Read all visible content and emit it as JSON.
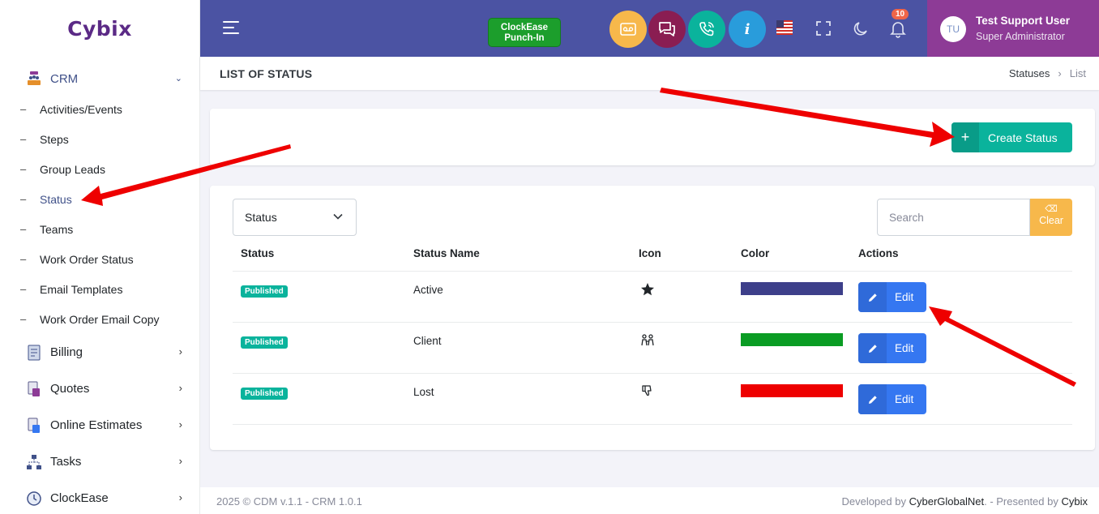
{
  "brand": {
    "logo_text": "Cybix"
  },
  "sidebar": {
    "crm": {
      "label": "CRM"
    },
    "crm_items": [
      {
        "label": "Activities/Events"
      },
      {
        "label": "Steps"
      },
      {
        "label": "Group Leads"
      },
      {
        "label": "Status",
        "active": true
      },
      {
        "label": "Teams"
      },
      {
        "label": "Work Order Status"
      },
      {
        "label": "Email Templates"
      },
      {
        "label": "Work Order Email Copy"
      }
    ],
    "main_items": [
      {
        "label": "Billing",
        "icon": "billing-icon"
      },
      {
        "label": "Quotes",
        "icon": "quotes-icon"
      },
      {
        "label": "Online Estimates",
        "icon": "estimates-icon"
      },
      {
        "label": "Tasks",
        "icon": "tasks-icon"
      },
      {
        "label": "ClockEase",
        "icon": "clock-icon"
      }
    ]
  },
  "topbar": {
    "punch_line1": "ClockEase",
    "punch_line2": "Punch-In",
    "notification_count": "10",
    "user_initials": "TU",
    "user_name": "Test Support User",
    "user_role": "Super Administrator",
    "colors": {
      "bar": "#4b53a3",
      "user_panel": "#8d3b96"
    }
  },
  "page": {
    "title": "LIST OF STATUS",
    "breadcrumb": [
      "Statuses",
      "List"
    ]
  },
  "actions": {
    "create_label": "Create Status",
    "create_symbol": "+"
  },
  "filters": {
    "status_select": "Status",
    "search_placeholder": "Search",
    "clear_label": "Clear"
  },
  "table": {
    "headers": [
      "Status",
      "Status Name",
      "Icon",
      "Color",
      "Actions"
    ],
    "rows": [
      {
        "status": "Published",
        "name": "Active",
        "icon": "star-icon",
        "color": "#3d3f8a",
        "action": "Edit"
      },
      {
        "status": "Published",
        "name": "Client",
        "icon": "people-icon",
        "color": "#0a9c23",
        "action": "Edit"
      },
      {
        "status": "Published",
        "name": "Lost",
        "icon": "thumbs-down-icon",
        "color": "#ee0000",
        "action": "Edit"
      }
    ]
  },
  "footer": {
    "left": "2025 © CDM v.1.1 - CRM 1.0.1",
    "developed_prefix": "Developed by ",
    "developer": "CyberGlobalNet",
    "presented_prefix": ". - Presented by ",
    "presenter": "Cybix"
  }
}
